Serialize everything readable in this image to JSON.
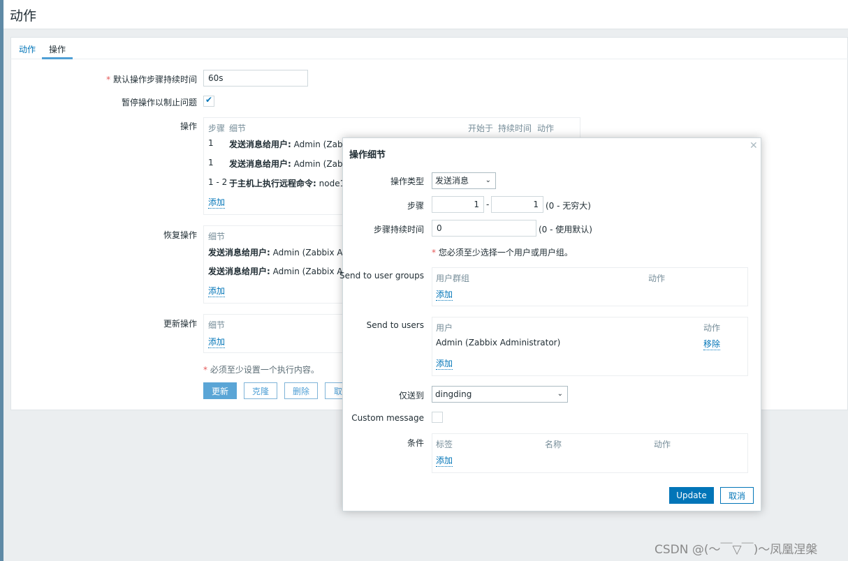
{
  "page": {
    "title": "动作",
    "tabs": [
      "动作",
      "操作"
    ],
    "active_tab": "操作"
  },
  "form": {
    "step_duration_label": "默认操作步骤持续时间",
    "step_duration_value": "60s",
    "pause_label": "暂停操作以制止问题",
    "pause_checked": true,
    "operations_label": "操作",
    "operations_headers": [
      "步骤",
      "细节",
      "开始于",
      "持续时间",
      "动作"
    ],
    "operations": [
      {
        "step": "1",
        "detail_bold": "发送消息给用户:",
        "detail": " Admin (Zabbi"
      },
      {
        "step": "1",
        "detail_bold": "发送消息给用户:",
        "detail": " Admin (Zabbi"
      },
      {
        "step": "1 - 2",
        "detail_bold": "于主机上执行远程命令:",
        "detail": " node1"
      }
    ],
    "add": "添加",
    "recovery_label": "恢复操作",
    "detail_header": "细节",
    "recovery": [
      {
        "detail_bold": "发送消息给用户:",
        "detail": " Admin (Zabbix Adm"
      },
      {
        "detail_bold": "发送消息给用户:",
        "detail": " Admin (Zabbix Adm"
      }
    ],
    "update_label": "更新操作",
    "note": "必须至少设置一个执行内容。",
    "buttons": {
      "update": "更新",
      "clone": "克隆",
      "delete": "删除",
      "cancel": "取"
    }
  },
  "dialog": {
    "title": "操作细节",
    "op_type_label": "操作类型",
    "op_type_value": "发送消息",
    "steps_label": "步骤",
    "step_from": "1",
    "step_to": "1",
    "steps_hint": "(0 - 无穷大)",
    "step_dur_label": "步骤持续时间",
    "step_dur_value": "0",
    "step_dur_hint": "(0 - 使用默认)",
    "note": "您必须至少选择一个用户或用户组。",
    "groups_label": "Send to user groups",
    "groups_headers": [
      "用户群组",
      "动作"
    ],
    "users_label": "Send to users",
    "users_headers": [
      "用户",
      "动作"
    ],
    "users": [
      {
        "name": "Admin (Zabbix Administrator)",
        "action": "移除"
      }
    ],
    "add": "添加",
    "only_to_label": "仅送到",
    "only_to_value": "dingding",
    "custom_label": "Custom message",
    "custom_checked": false,
    "conditions_label": "条件",
    "conditions_headers": [
      "标签",
      "名称",
      "动作"
    ],
    "update": "Update",
    "cancel": "取消"
  },
  "watermark": "CSDN @(～￣▽￣)～凤凰涅槃",
  "colors": {
    "accent": "#0275b8",
    "sidebar": "#5f8aa6"
  }
}
